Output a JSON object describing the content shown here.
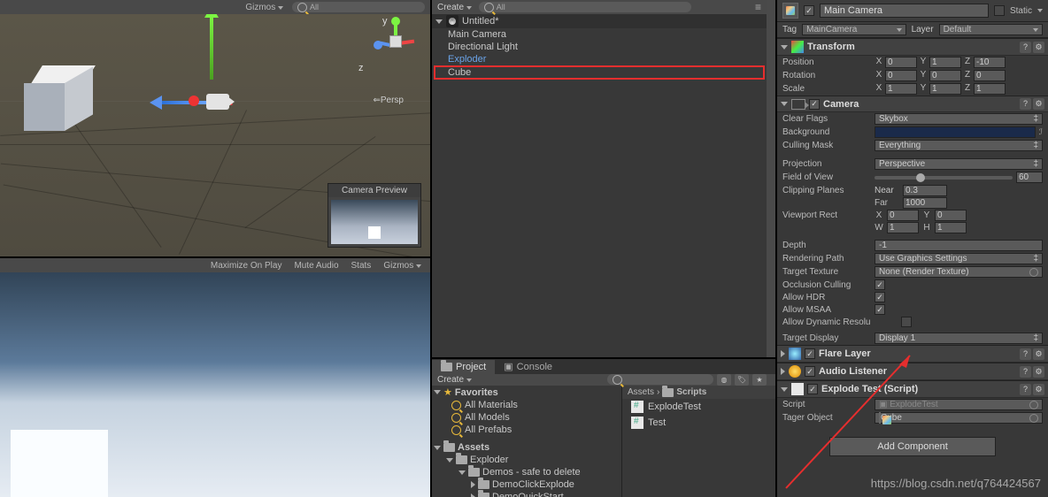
{
  "scene_toolbar": {
    "gizmos": "Gizmos",
    "search_placeholder": "All"
  },
  "persp": "Persp",
  "miniAxes": {
    "z": "z",
    "y": "y"
  },
  "cam_preview": "Camera Preview",
  "game_toolbar": {
    "maximize": "Maximize On Play",
    "mute": "Mute Audio",
    "stats": "Stats",
    "gizmos": "Gizmos"
  },
  "hierarchy": {
    "create": "Create",
    "search_placeholder": "All",
    "scene": "Untitled*",
    "items": [
      {
        "label": "Main Camera",
        "link": false
      },
      {
        "label": "Directional Light",
        "link": false
      },
      {
        "label": "Exploder",
        "link": true
      },
      {
        "label": "Cube",
        "link": false,
        "highlight": true
      }
    ]
  },
  "project": {
    "tabProject": "Project",
    "tabConsole": "Console",
    "create": "Create",
    "favorites": "Favorites",
    "favItems": [
      "All Materials",
      "All Models",
      "All Prefabs"
    ],
    "assets": "Assets",
    "tree": [
      {
        "label": "Exploder",
        "depth": 1,
        "open": true
      },
      {
        "label": "Demos - safe to delete",
        "depth": 2,
        "open": true
      },
      {
        "label": "DemoClickExplode",
        "depth": 3,
        "open": false
      },
      {
        "label": "DemoQuickStart",
        "depth": 3,
        "open": false
      }
    ],
    "breadcrumb": [
      "Assets",
      "Scripts"
    ],
    "files": [
      "ExplodeTest",
      "Test"
    ]
  },
  "inspector": {
    "goName": "Main Camera",
    "static": "Static",
    "tagLabel": "Tag",
    "tagValue": "MainCamera",
    "layerLabel": "Layer",
    "layerValue": "Default",
    "transform": {
      "title": "Transform",
      "position": {
        "label": "Position",
        "x": "0",
        "y": "1",
        "z": "-10"
      },
      "rotation": {
        "label": "Rotation",
        "x": "0",
        "y": "0",
        "z": "0"
      },
      "scale": {
        "label": "Scale",
        "x": "1",
        "y": "1",
        "z": "1"
      }
    },
    "camera": {
      "title": "Camera",
      "clearFlags": {
        "label": "Clear Flags",
        "value": "Skybox"
      },
      "background": "Background",
      "cullingMask": {
        "label": "Culling Mask",
        "value": "Everything"
      },
      "projection": {
        "label": "Projection",
        "value": "Perspective"
      },
      "fov": {
        "label": "Field of View",
        "value": "60"
      },
      "clipping": {
        "label": "Clipping Planes",
        "near": "Near",
        "nearV": "0.3",
        "far": "Far",
        "farV": "1000"
      },
      "viewport": {
        "label": "Viewport Rect",
        "x": "0",
        "y": "0",
        "w": "1",
        "h": "1"
      },
      "depth": {
        "label": "Depth",
        "value": "-1"
      },
      "renderPath": {
        "label": "Rendering Path",
        "value": "Use Graphics Settings"
      },
      "targetTex": {
        "label": "Target Texture",
        "value": "None (Render Texture)"
      },
      "occ": "Occlusion Culling",
      "hdr": "Allow HDR",
      "msaa": "Allow MSAA",
      "dyn": "Allow Dynamic Resolu",
      "targetDisplay": {
        "label": "Target Display",
        "value": "Display 1"
      }
    },
    "flare": "Flare Layer",
    "audio": "Audio Listener",
    "explode": {
      "title": "Explode Test (Script)",
      "scriptLabel": "Script",
      "scriptValue": "ExplodeTest",
      "targetLabel": "Tager Object",
      "targetValue": "Cube"
    },
    "addComponent": "Add Component"
  },
  "watermark": "https://blog.csdn.net/q764424567"
}
